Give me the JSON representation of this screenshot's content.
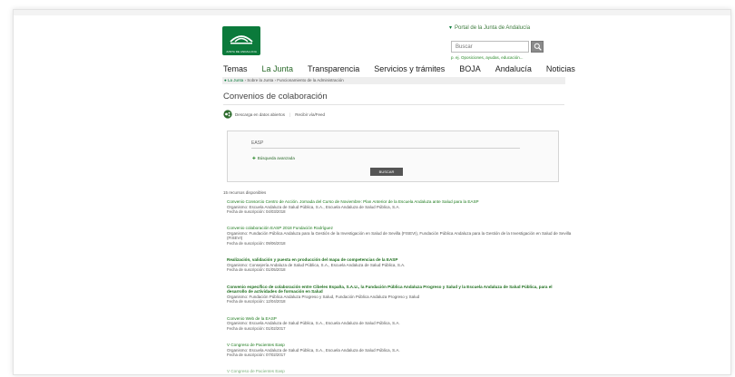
{
  "header": {
    "logo_text": "JUNTA DE ANDALUCIA",
    "portal_link": "Portal de la Junta de Andalucía",
    "search_placeholder": "Buscar",
    "search_hint": "p. ej. Oposiciones, ayudas, educación..."
  },
  "nav": {
    "items": [
      "Temas",
      "La Junta",
      "Transparencia",
      "Servicios y trámites",
      "BOJA",
      "Andalucía",
      "Noticias"
    ]
  },
  "breadcrumb": {
    "home": "La Junta",
    "path": "› Sobre la Junta › Funcionamiento de la Administración"
  },
  "page": {
    "title": "Convenios de colaboración",
    "download_label": "Descarga en datos abiertos",
    "rss_label": "Recibir vía/Feed"
  },
  "filter": {
    "input_value": "EASP",
    "advanced_label": "Búsqueda avanzada",
    "submit_label": "BUSCAR"
  },
  "results": {
    "count_label": "15 recursos disponibles",
    "items": [
      {
        "title": "Convenio Consorcio Centro de Acción. Jornada del Curso de Noviembre: Plan Anterior de la Escuela Andaluza ante Salud para la EASP",
        "org": "Organismo: Escuela Andaluza de Salud Pública, S.A., Escuela Andaluza de Salud Pública, S.A.",
        "date": "Fecha de suscripción: 04/03/2018"
      },
      {
        "title": "Convenio colaboración EASP 2018 Fundación Rodríguez",
        "org": "Organismo: Fundación Pública Andaluza para la Gestión de la Investigación en Salud de Sevilla (FISEVI), Fundación Pública Andaluza para la Gestión de la Investigación en Salud de Sevilla (FISEVI)",
        "date": "Fecha de suscripción: 09/06/2018"
      },
      {
        "title": "Realización, validación y puesta en producción del mapa de competencias de la EASP",
        "org": "Organismo: Consejería Andaluza de Salud Pública, S.A., Escuela Andaluza de Salud Pública, S.A.",
        "date": "Fecha de suscripción: 01/05/2018"
      },
      {
        "title": "Convenio específico de colaboración entre Cibeles España, S.A.U., la Fundación Pública Andaluza Progreso y Salud y la Escuela Andaluza de Salud Pública, para el desarrollo de actividades de formación en Salud",
        "org": "Organismo: Fundación Pública Andaluza Progreso y Salud, Fundación Pública Andaluza Progreso y Salud",
        "date": "Fecha de suscripción: 12/04/2018"
      },
      {
        "title": "Convenio Web de la EASP",
        "org": "Organismo: Escuela Andaluza de Salud Pública, S.A., Escuela Andaluza de Salud Pública, S.A.",
        "date": "Fecha de suscripción: 01/02/2017"
      },
      {
        "title": "V Congreso de Pacientes Easp",
        "org": "Organismo: Escuela Andaluza de Salud Pública, S.A., Escuela Andaluza de Salud Pública, S.A.",
        "date": "Fecha de suscripción: 07/02/2017"
      }
    ],
    "trailing_title": "V Congreso de Pacientes Easp"
  },
  "colors": {
    "brand_green": "#0b7a3b",
    "link_green": "#1d7a1d"
  }
}
